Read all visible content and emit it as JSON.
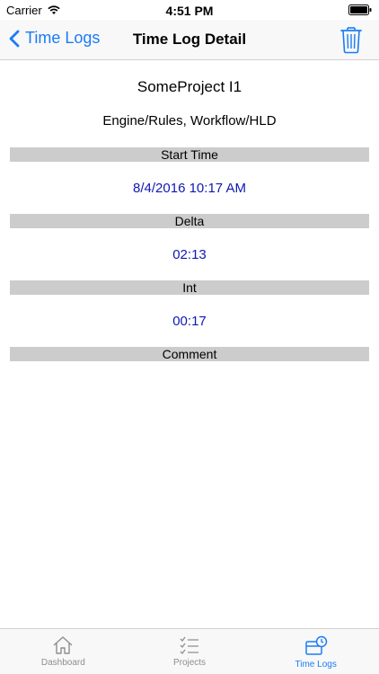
{
  "status_bar": {
    "carrier": "Carrier",
    "time": "4:51 PM"
  },
  "nav": {
    "back_label": "Time Logs",
    "title": "Time Log Detail",
    "trash_icon": "trash-icon"
  },
  "detail": {
    "project": "SomeProject I1",
    "task": "Engine/Rules, Workflow/HLD",
    "sections": [
      {
        "header": "Start Time",
        "value": "8/4/2016 10:17 AM"
      },
      {
        "header": "Delta",
        "value": "02:13"
      },
      {
        "header": "Int",
        "value": "00:17"
      },
      {
        "header": "Comment",
        "value": ""
      }
    ]
  },
  "tabs": [
    {
      "label": "Dashboard",
      "icon": "home-icon",
      "active": false
    },
    {
      "label": "Projects",
      "icon": "checklist-icon",
      "active": false
    },
    {
      "label": "Time Logs",
      "icon": "time-log-icon",
      "active": true
    }
  ],
  "colors": {
    "accent": "#1a7cf5",
    "value_text": "#0f18b0",
    "section_bg": "#cccccc",
    "tab_inactive": "#8e8e8e"
  }
}
